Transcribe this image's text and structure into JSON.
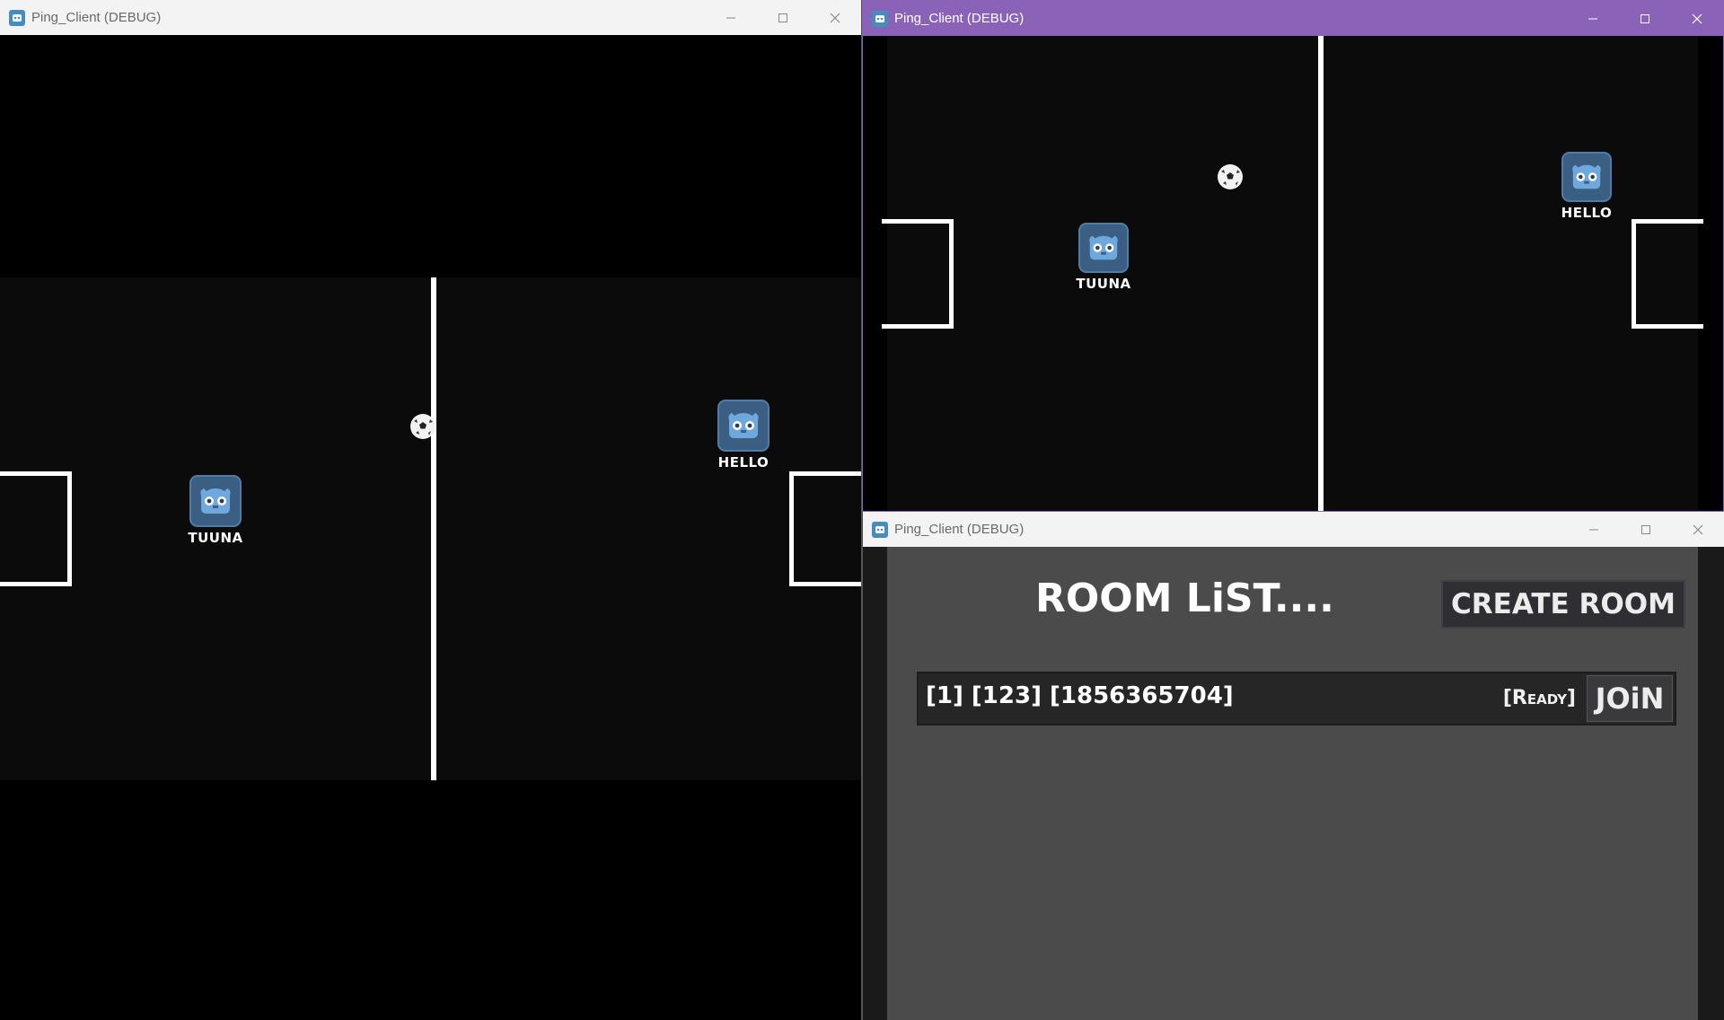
{
  "colors": {
    "title_active_purple": "#8a63b8",
    "title_inactive": "#f3f3f3",
    "game_bg": "#000000",
    "field_bg": "#0b0b0b",
    "lobby_bg": "#4b4b4b",
    "button_bg": "#2f2f33",
    "row_bg": "#262626",
    "godot_blue": "#478cbf"
  },
  "windows": [
    {
      "title": "Ping_Client (DEBUG)",
      "state": "inactive",
      "players": [
        {
          "name": "TUUNA",
          "icon": "godot-icon"
        },
        {
          "name": "HELLO",
          "icon": "godot-icon"
        }
      ],
      "ball_icon": "soccer-ball-icon"
    },
    {
      "title": "Ping_Client (DEBUG)",
      "state": "active",
      "players": [
        {
          "name": "TUUNA",
          "icon": "godot-icon"
        },
        {
          "name": "HELLO",
          "icon": "godot-icon"
        }
      ],
      "ball_icon": "soccer-ball-icon"
    },
    {
      "title": "Ping_Client (DEBUG)",
      "state": "inactive",
      "lobby": {
        "title": "ROOM LiST....",
        "create_button": "CREATE ROOM",
        "rooms": [
          {
            "info": "[1] [123] [1856365704]",
            "status": "[Ready]",
            "join_label": "JOiN"
          }
        ]
      }
    }
  ],
  "window_controls": [
    "minimize-icon",
    "maximize-icon",
    "close-icon"
  ]
}
